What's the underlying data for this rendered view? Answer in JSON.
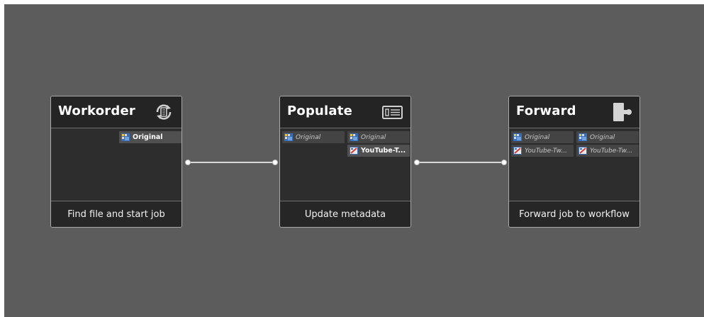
{
  "nodes": [
    {
      "title": "Workorder",
      "icon": "workorder-icon",
      "footer": "Find file and start job",
      "slots": [
        {
          "label": "Original"
        }
      ]
    },
    {
      "title": "Populate",
      "icon": "populate-icon",
      "footer": "Update metadata",
      "slots": [
        {
          "label": "Original"
        },
        {
          "label": "Original"
        },
        {
          "label": "YouTube-T..."
        }
      ]
    },
    {
      "title": "Forward",
      "icon": "forward-icon",
      "footer": "Forward job to workflow",
      "slots": [
        {
          "label": "Original"
        },
        {
          "label": "Original"
        },
        {
          "label": "YouTube-Tw..."
        },
        {
          "label": "YouTube-Tw..."
        }
      ]
    }
  ],
  "colors": {
    "canvas": "#5c5c5c",
    "node_body": "#2d2d2d",
    "node_border": "#a9a9a9",
    "connector": "#d8d8d8"
  }
}
